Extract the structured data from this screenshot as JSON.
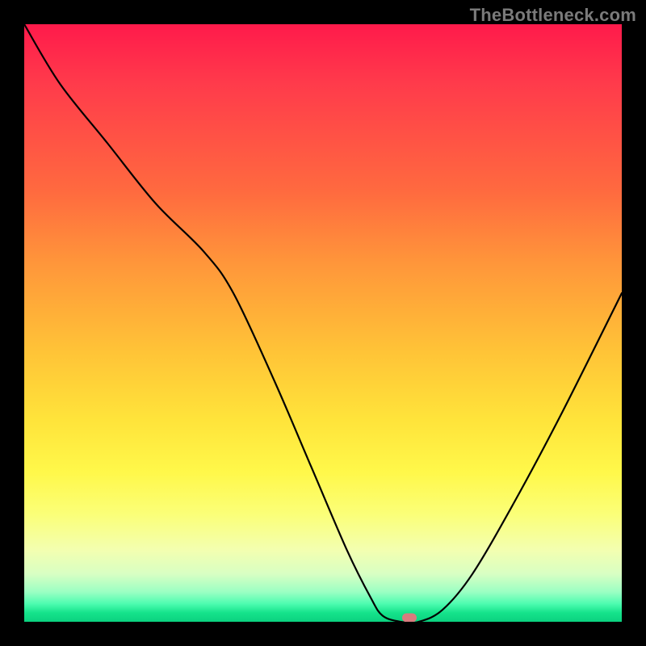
{
  "watermark": "TheBottleneck.com",
  "chart_data": {
    "type": "line",
    "title": "",
    "xlabel": "",
    "ylabel": "",
    "xlim": [
      0,
      100
    ],
    "ylim": [
      0,
      100
    ],
    "grid": false,
    "legend": false,
    "background": "red-yellow-green vertical gradient (red top, green bottom)",
    "series": [
      {
        "name": "bottleneck-curve",
        "x": [
          0,
          6,
          14,
          22,
          30,
          35,
          42,
          48,
          54,
          58,
          60,
          63,
          66,
          70,
          75,
          82,
          90,
          100
        ],
        "values": [
          100,
          90,
          80,
          70,
          62,
          55,
          40,
          26,
          12,
          4,
          1,
          0,
          0,
          2,
          8,
          20,
          35,
          55
        ]
      }
    ],
    "marker": {
      "x": 64.5,
      "y": 0.7
    },
    "gradient_stops": [
      {
        "pos": 0,
        "color": "#ff1a4b"
      },
      {
        "pos": 0.5,
        "color": "#ffc437"
      },
      {
        "pos": 0.8,
        "color": "#fff84a"
      },
      {
        "pos": 0.95,
        "color": "#9bffc3"
      },
      {
        "pos": 1.0,
        "color": "#0bd17f"
      }
    ]
  }
}
